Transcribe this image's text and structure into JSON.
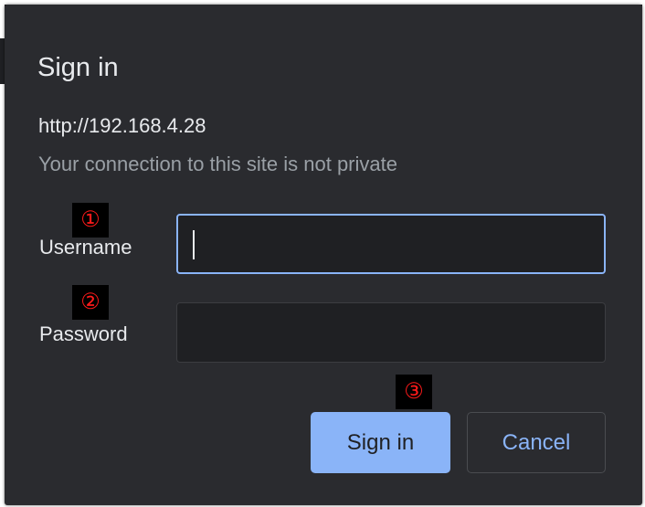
{
  "dialog": {
    "title": "Sign in",
    "url": "http://192.168.4.28",
    "warning": "Your connection to this site is not private"
  },
  "form": {
    "username_label": "Username",
    "username_value": "",
    "password_label": "Password",
    "password_value": ""
  },
  "markers": [
    "①",
    "②",
    "③"
  ],
  "buttons": {
    "sign_in": "Sign in",
    "cancel": "Cancel"
  },
  "colors": {
    "dialog_background": "#2a2b2f",
    "field_background": "#1f2023",
    "accent": "#8ab4f8",
    "marker_text": "#ff1a1a"
  }
}
